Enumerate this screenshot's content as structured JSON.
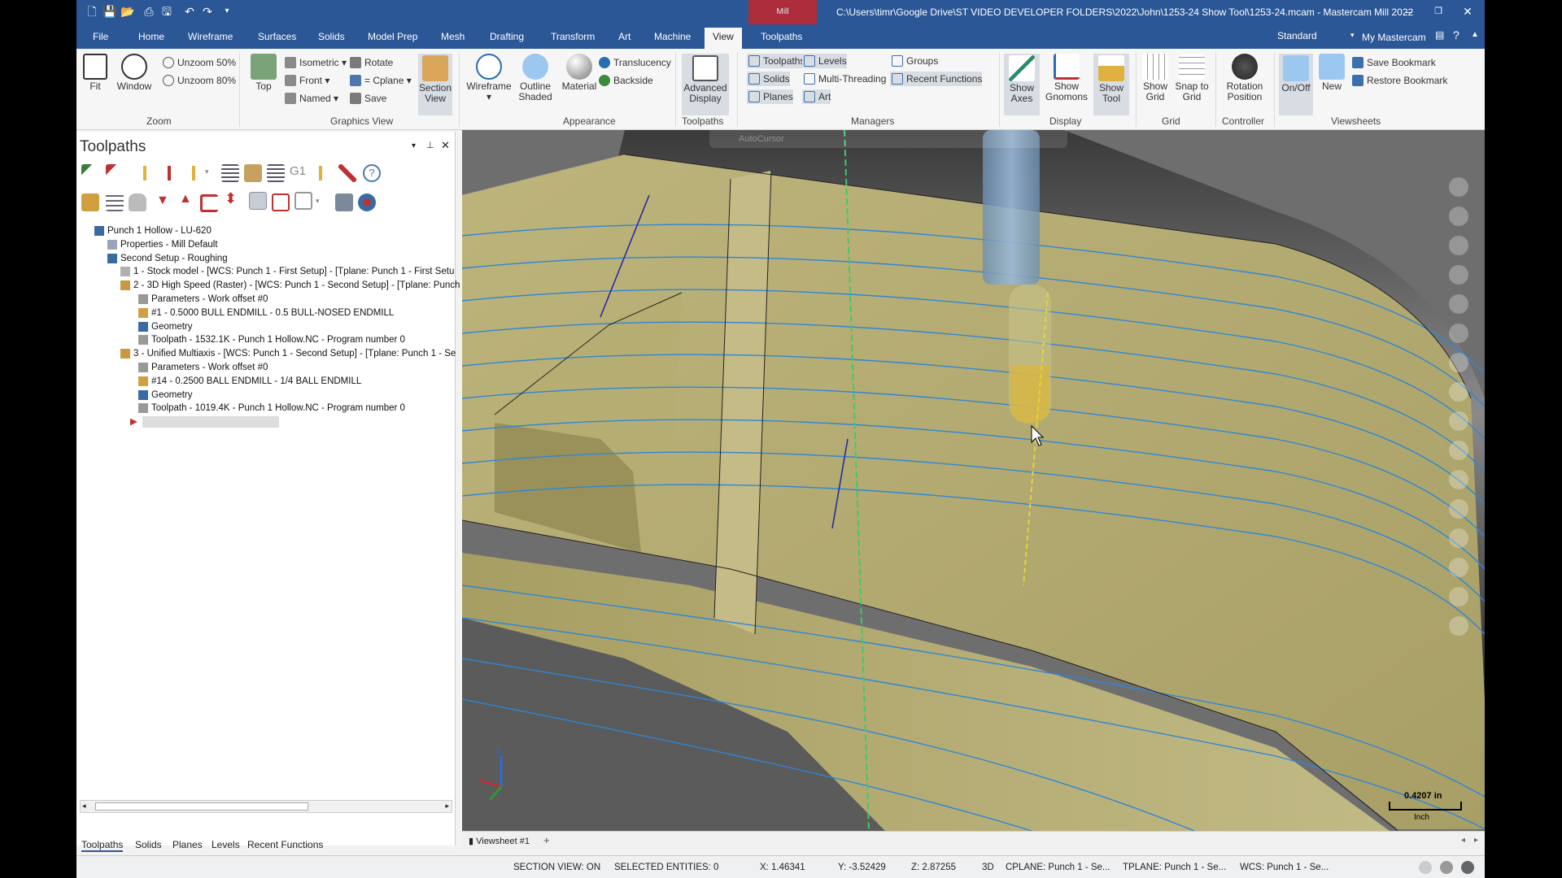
{
  "titlebar": {
    "path": "C:\\Users\\timr\\Google Drive\\ST VIDEO DEVELOPER FOLDERS\\2022\\John\\1253-24 Show Tool\\1253-24.mcam - Mastercam Mill 2022",
    "badge": "Mill"
  },
  "menu": {
    "tabs": [
      "File",
      "Home",
      "Wireframe",
      "Surfaces",
      "Solids",
      "Model Prep",
      "Mesh",
      "Drafting",
      "Transform",
      "Art",
      "Machine",
      "View",
      "Toolpaths"
    ],
    "active": "View",
    "right_standard": "Standard",
    "right_my": "My Mastercam"
  },
  "ribbon": {
    "zoom": {
      "label": "Zoom",
      "fit": "Fit",
      "window": "Window",
      "unzoom50": "Unzoom 50%",
      "unzoom80": "Unzoom 80%"
    },
    "graphics_view": {
      "label": "Graphics View",
      "top": "Top",
      "isometric": "Isometric",
      "front": "Front",
      "named": "Named",
      "rotate": "Rotate",
      "cplane": "= Cplane",
      "save": "Save",
      "section_view": "Section View"
    },
    "appearance": {
      "label": "Appearance",
      "wireframe": "Wireframe",
      "outline_shaded": "Outline Shaded",
      "material": "Material",
      "translucency": "Translucency",
      "backside": "Backside"
    },
    "toolpaths": {
      "label": "Toolpaths",
      "advanced_display": "Advanced Display"
    },
    "managers": {
      "label": "Managers",
      "toolpaths": "Toolpaths",
      "solids": "Solids",
      "planes": "Planes",
      "levels": "Levels",
      "multi_threading": "Multi-Threading",
      "art": "Art",
      "groups": "Groups",
      "recent_functions": "Recent Functions"
    },
    "display": {
      "label": "Display",
      "show_axes": "Show Axes",
      "show_gnomons": "Show Gnomons",
      "show_tool": "Show Tool"
    },
    "grid": {
      "label": "Grid",
      "show_grid": "Show Grid",
      "snap_to_grid": "Snap to Grid"
    },
    "controller": {
      "label": "Controller",
      "rotation_position": "Rotation Position"
    },
    "viewsheets": {
      "label": "Viewsheets",
      "on_off": "On/Off",
      "new": "New",
      "save_bookmark": "Save Bookmark",
      "restore_bookmark": "Restore Bookmark"
    }
  },
  "panel": {
    "title": "Toolpaths",
    "tree": [
      "Punch 1 Hollow - LU-620",
      "Properties - Mill Default",
      "Second Setup - Roughing",
      "1 - Stock model - [WCS: Punch 1 - First Setup] - [Tplane: Punch 1 - First Setu",
      "2 - 3D High Speed (Raster) - [WCS: Punch 1 - Second Setup] - [Tplane: Punch",
      "Parameters - Work offset #0",
      "#1 - 0.5000 BULL ENDMILL - 0.5 BULL-NOSED ENDMILL",
      "Geometry",
      "Toolpath - 1532.1K - Punch 1 Hollow.NC - Program number 0",
      "3 - Unified Multiaxis - [WCS: Punch 1 - Second Setup] - [Tplane: Punch 1 - Se",
      "Parameters - Work offset #0",
      "#14 - 0.2500 BALL ENDMILL - 1/4 BALL ENDMILL",
      "Geometry",
      "Toolpath - 1019.4K - Punch 1 Hollow.NC - Program number 0"
    ],
    "bottom_tabs": [
      "Toolpaths",
      "Solids",
      "Planes",
      "Levels",
      "Recent Functions"
    ]
  },
  "viewport": {
    "autocursor": "AutoCursor",
    "scale_value": "0.4207 in",
    "scale_unit": "Inch",
    "viewsheet": "Viewsheet #1",
    "axis_z": "Z"
  },
  "status": {
    "section_view": "SECTION VIEW: ON",
    "selected": "SELECTED ENTITIES: 0",
    "x": "X:  1.46341",
    "y": "Y:  -3.52429",
    "z": "Z:  2.87255",
    "mode": "3D",
    "cplane": "CPLANE: Punch 1 - Se...",
    "tplane": "TPLANE: Punch 1 - Se...",
    "wcs": "WCS: Punch 1 - Se..."
  },
  "colors": {
    "title_blue": "#2b5797",
    "part_surface": "#b8b07a",
    "toolpath_line": "#2f86d6"
  }
}
